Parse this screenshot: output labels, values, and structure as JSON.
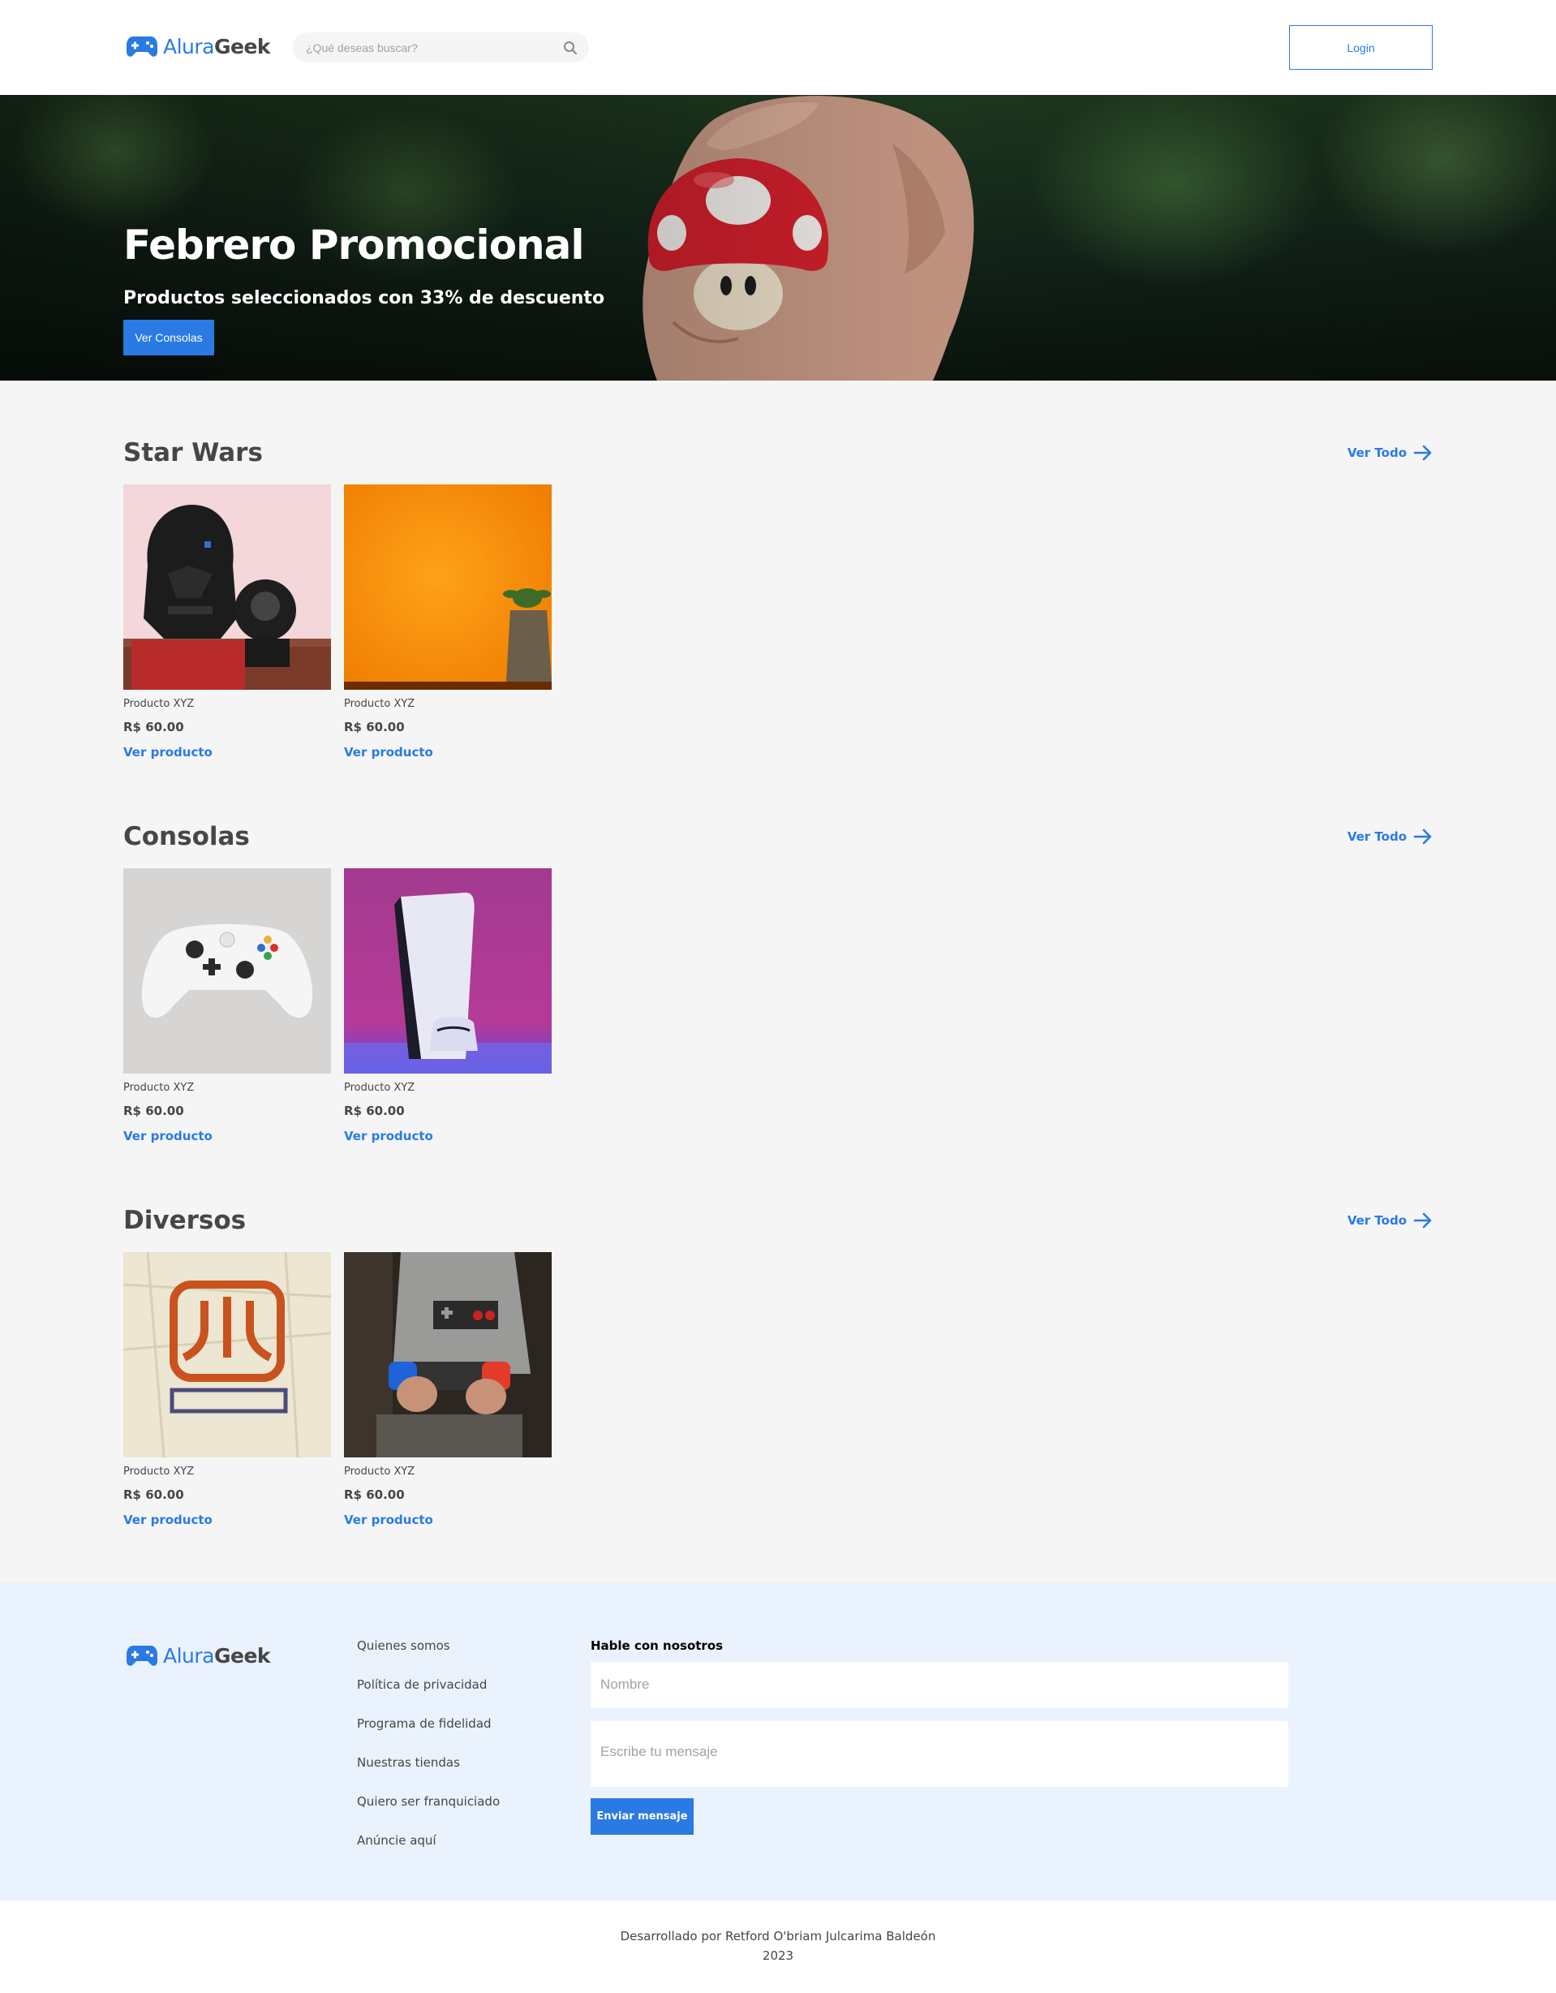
{
  "brand": {
    "part1": "Alura",
    "part2": "Geek",
    "icon": "gamepad-icon",
    "accent": "#2A7AE4",
    "text_color": "#464646"
  },
  "header": {
    "search_placeholder": "¿Qué deseas buscar?",
    "search_icon": "search-icon",
    "login_label": "Login"
  },
  "hero": {
    "title": "Febrero Promocional",
    "subtitle": "Productos seleccionados con 33% de descuento",
    "button_label": "Ver Consolas"
  },
  "categories": [
    {
      "title": "Star Wars",
      "see_all_label": "Ver Todo",
      "products": [
        {
          "name": "Producto XYZ",
          "price": "R$ 60.00",
          "link": "Ver producto",
          "image": "darth-vader-lego-helmets"
        },
        {
          "name": "Producto XYZ",
          "price": "R$ 60.00",
          "link": "Ver producto",
          "image": "yoda-figure-orange-background"
        }
      ]
    },
    {
      "title": "Consolas",
      "see_all_label": "Ver Todo",
      "products": [
        {
          "name": "Producto XYZ",
          "price": "R$ 60.00",
          "link": "Ver producto",
          "image": "xbox-controller"
        },
        {
          "name": "Producto XYZ",
          "price": "R$ 60.00",
          "link": "Ver producto",
          "image": "playstation-5-console"
        }
      ]
    },
    {
      "title": "Diversos",
      "see_all_label": "Ver Todo",
      "products": [
        {
          "name": "Producto XYZ",
          "price": "R$ 60.00",
          "link": "Ver producto",
          "image": "atari-logo-tshirt"
        },
        {
          "name": "Producto XYZ",
          "price": "R$ 60.00",
          "link": "Ver producto",
          "image": "child-with-switch-controller"
        }
      ]
    }
  ],
  "footer": {
    "links": [
      "Quienes somos",
      "Política de privacidad",
      "Programa de fidelidad",
      "Nuestras tiendas",
      "Quiero ser franquiciado",
      "Anúncie aquí"
    ],
    "contact_title": "Hable con nosotros",
    "name_placeholder": "Nombre",
    "message_placeholder": "Escribe tu mensaje",
    "send_label": "Enviar mensaje"
  },
  "credits": {
    "line1": "Desarrollado por Retford O'briam Julcarima Baldeón",
    "line2": "2023"
  }
}
